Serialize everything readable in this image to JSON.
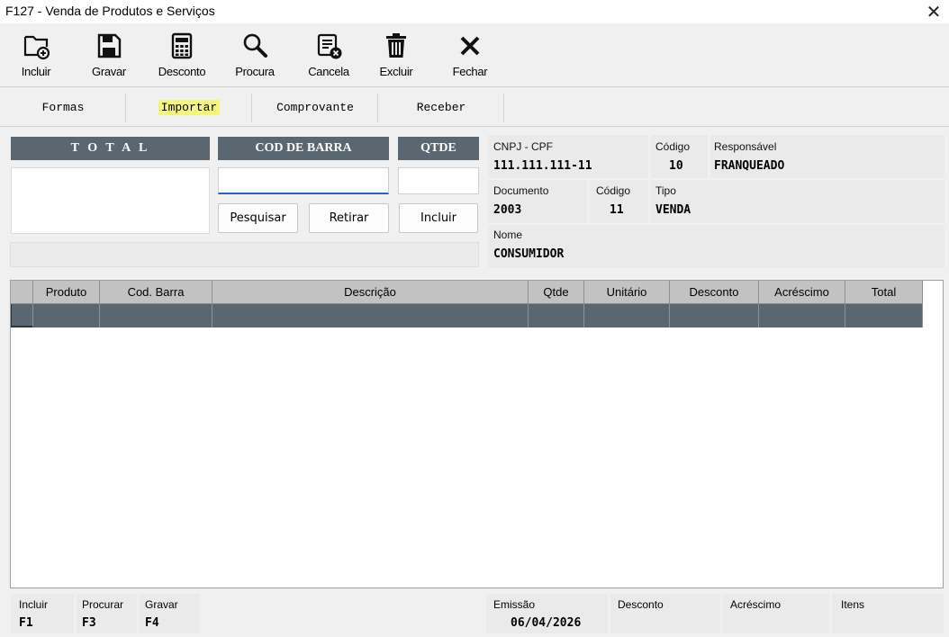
{
  "window": {
    "title": "F127 - Venda de Produtos e Serviços",
    "close_icon": "close-icon"
  },
  "toolbar": [
    {
      "label": "Incluir",
      "icon": "folder-add-icon"
    },
    {
      "label": "Gravar",
      "icon": "floppy-disk-icon"
    },
    {
      "label": "Desconto",
      "icon": "calculator-icon"
    },
    {
      "label": "Procura",
      "icon": "magnifier-icon"
    },
    {
      "label": "Cancela",
      "icon": "document-cancel-icon"
    },
    {
      "label": "Excluir",
      "icon": "trash-icon"
    },
    {
      "label": "Fechar",
      "icon": "close-x-icon"
    }
  ],
  "menu": [
    {
      "label": "Formas"
    },
    {
      "label": "Importar",
      "highlight": "#f5f57a"
    },
    {
      "label": "Comprovante"
    },
    {
      "label": "Receber"
    }
  ],
  "entry": {
    "total_header": "T O T A L",
    "barcode_header": "COD DE BARRA",
    "qtde_header": "QTDE",
    "total_value": "",
    "barcode_value": "",
    "qtde_value": "",
    "buttons": {
      "pesquisar": "Pesquisar",
      "retirar": "Retirar",
      "incluir": "Incluir"
    }
  },
  "info": {
    "cnpj_label": "CNPJ - CPF",
    "cnpj_value": "111.111.111-11",
    "codigo1_label": "Código",
    "codigo1_value": "10",
    "responsavel_label": "Responsável",
    "responsavel_value": "FRANQUEADO",
    "documento_label": "Documento",
    "documento_value": "2003",
    "codigo2_label": "Código",
    "codigo2_value": "11",
    "tipo_label": "Tipo",
    "tipo_value": "VENDA",
    "nome_label": "Nome",
    "nome_value": "CONSUMIDOR"
  },
  "grid": {
    "columns": [
      "Produto",
      "Cod. Barra",
      "Descrição",
      "Qtde",
      "Unitário",
      "Desconto",
      "Acréscimo",
      "Total"
    ],
    "rows": [
      [
        "",
        "",
        "",
        "",
        "",
        "",
        "",
        ""
      ]
    ]
  },
  "footer": {
    "shortcuts": [
      {
        "label": "Incluir",
        "key": "F1"
      },
      {
        "label": "Procurar",
        "key": "F3"
      },
      {
        "label": "Gravar",
        "key": "F4"
      }
    ],
    "emissao_label": "Emissão",
    "emissao_value": "06/04/2026",
    "desconto_label": "Desconto",
    "acrescimo_label": "Acréscimo",
    "itens_label": "Itens"
  },
  "colors": {
    "header_bg": "#5a6770",
    "focus_underline": "#2b62b8",
    "highlight": "#f5f57a"
  }
}
